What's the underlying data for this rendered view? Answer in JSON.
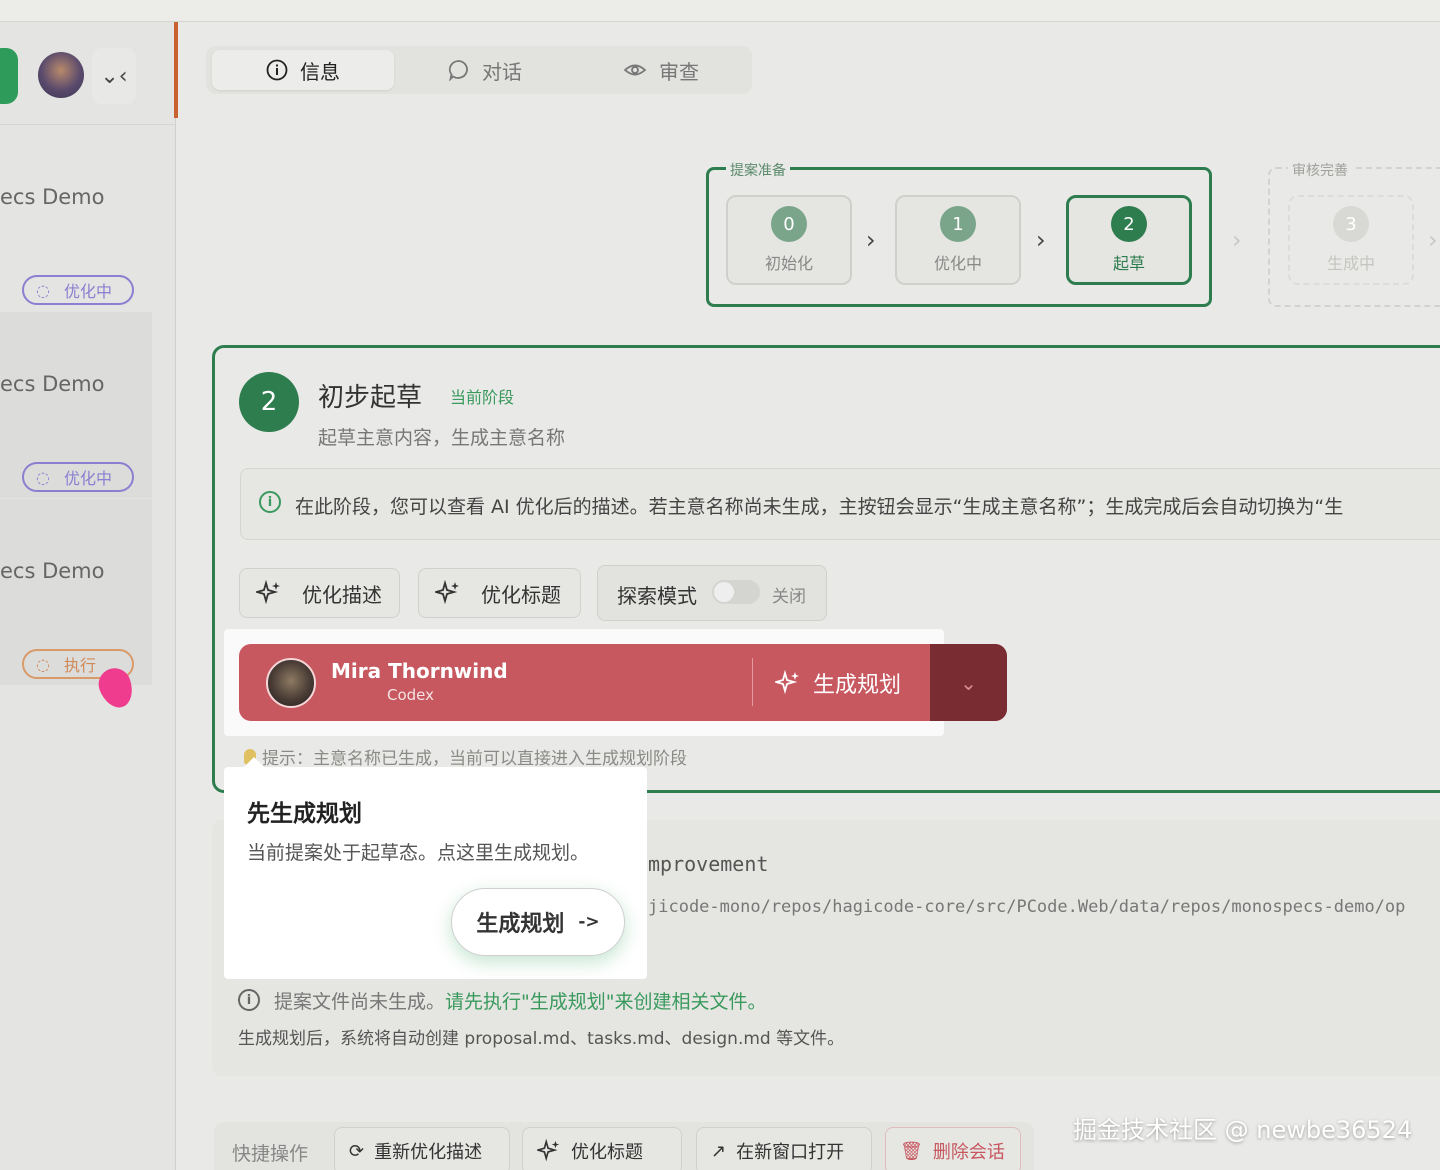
{
  "sidebar": {
    "items": [
      {
        "title": "ecs Demo",
        "badge": "优化中",
        "kind": "spin"
      },
      {
        "title": "ecs Demo",
        "badge": "优化中",
        "kind": "spin"
      },
      {
        "title": "ecs Demo",
        "badge": "执行",
        "kind": "exec"
      }
    ]
  },
  "tabs": [
    {
      "label": "信息",
      "icon": "info-icon"
    },
    {
      "label": "对话",
      "icon": "chat-icon"
    },
    {
      "label": "审查",
      "icon": "eye-icon"
    }
  ],
  "stepper": {
    "group1_label": "提案准备",
    "group2_label": "审核完善",
    "steps": [
      {
        "num": "0",
        "label": "初始化"
      },
      {
        "num": "1",
        "label": "优化中"
      },
      {
        "num": "2",
        "label": "起草"
      },
      {
        "num": "3",
        "label": "生成中"
      }
    ]
  },
  "stage": {
    "number": "2",
    "title": "初步起草",
    "current": "当前阶段",
    "desc": "起草主意内容，生成主意名称",
    "info": "在此阶段，您可以查看 AI 优化后的描述。若主意名称尚未生成，主按钮会显示“生成主意名称”；生成完成后会自动切换为“生"
  },
  "actions": {
    "optimize_desc": "优化描述",
    "optimize_title": "优化标题",
    "explore_mode": "探索模式",
    "explore_state": "关闭"
  },
  "agent": {
    "name": "Mira Thornwind",
    "sub": "Codex",
    "action": "生成规划",
    "accent": "#c75860"
  },
  "hint": "提示：主意名称已生成，当前可以直接进入生成规划阶段",
  "popover": {
    "title": "先生成规划",
    "text": "当前提案处于起草态。点这里生成规划。",
    "button": "生成规划",
    "arrow": "->"
  },
  "files": {
    "line1": "mprovement",
    "line2": "jicode-mono/repos/hagicode-core/src/PCode.Web/data/repos/monospecs-demo/op",
    "warn_prefix": "提案文件尚未生成。",
    "warn_link": "请先执行\"生成规划\"来创建相关文件。",
    "gen_note": "生成规划后，系统将自动创建 proposal.md、tasks.md、design.md 等文件。"
  },
  "quick": {
    "label": "快捷操作",
    "buttons": [
      "重新优化描述",
      "优化标题",
      "在新窗口打开",
      "删除会话"
    ]
  },
  "watermark": "掘金技术社区 @ newbe36524",
  "brand_green": "#2e7d4f"
}
